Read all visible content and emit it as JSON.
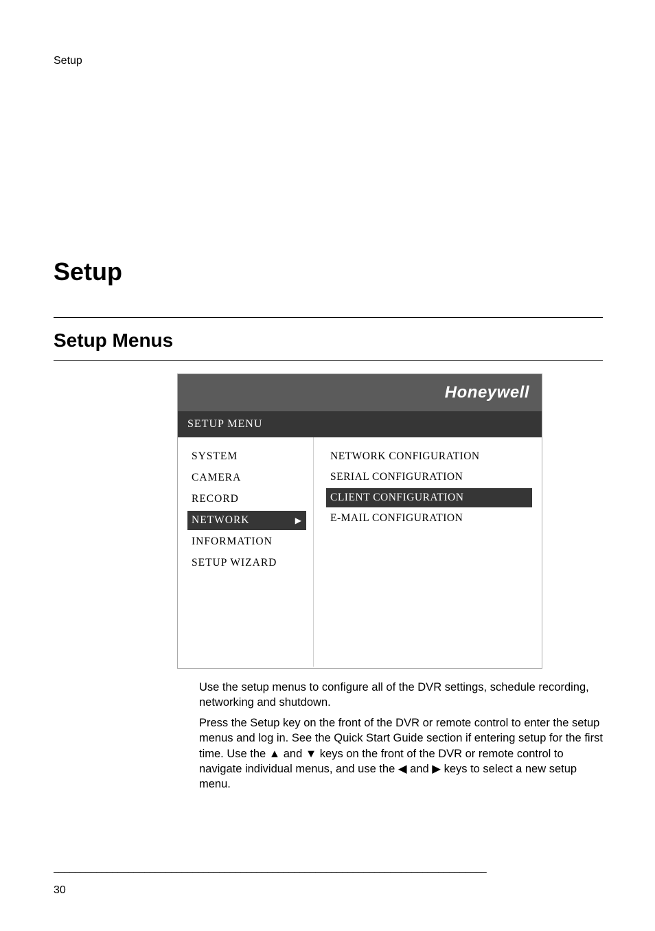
{
  "header": {
    "section_label": "Setup"
  },
  "chapter": {
    "title": "Setup"
  },
  "section": {
    "title": "Setup Menus"
  },
  "screenshot": {
    "brand": "Honeywell",
    "menu_title": "SETUP MENU",
    "left_menu": {
      "item0": "SYSTEM",
      "item1": "CAMERA",
      "item2": "RECORD",
      "item3": "NETWORK",
      "item4": "INFORMATION",
      "item5": "SETUP WIZARD"
    },
    "right_menu": {
      "item0": "NETWORK CONFIGURATION",
      "item1": "SERIAL CONFIGURATION",
      "item2": "CLIENT CONFIGURATION",
      "item3": "E-MAIL CONFIGURATION"
    }
  },
  "body": {
    "para1": "Use the setup menus to configure all of the DVR settings, schedule recording, networking and shutdown.",
    "para2_a": "Press the Setup key on the front of the DVR or remote control to enter the setup menus and log in. See the Quick Start Guide section if entering setup for the first time. Use the ",
    "para2_b": " and ",
    "para2_c": " keys on the front of the DVR or remote control to navigate individual menus, and use the ",
    "para2_d": " and ",
    "para2_e": " keys to select a new setup menu."
  },
  "glyphs": {
    "up": "▲",
    "down": "▼",
    "left": "◀",
    "right": "▶",
    "right_small": "▶"
  },
  "footer": {
    "rule": "_________________________________________________________________________________",
    "page": "30"
  },
  "chart_data": null
}
